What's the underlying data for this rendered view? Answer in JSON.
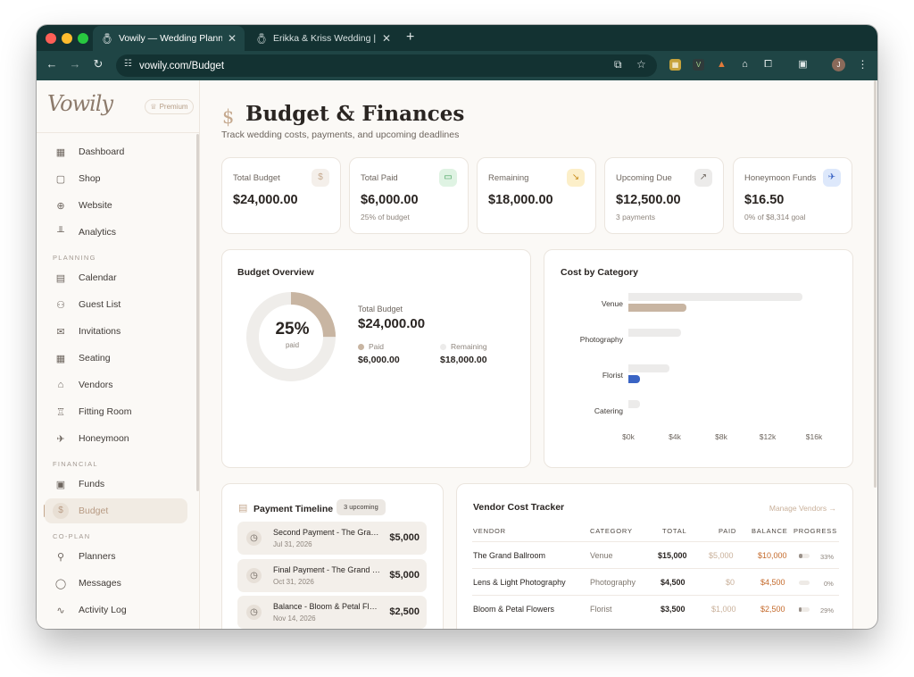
{
  "browser": {
    "tabs": [
      {
        "title": "Vowily — Wedding Planner, H",
        "active": true
      },
      {
        "title": "Erikka & Kriss Wedding | Nov",
        "active": false
      }
    ],
    "url": "vowily.com/Budget",
    "profile_initial": "J"
  },
  "sidebar": {
    "logo": "Vowily",
    "premium_label": "Premium",
    "items_top": [
      {
        "label": "Dashboard",
        "icon": "grid-icon"
      },
      {
        "label": "Shop",
        "icon": "bag-icon"
      },
      {
        "label": "Website",
        "icon": "globe-icon"
      },
      {
        "label": "Analytics",
        "icon": "chart-icon"
      }
    ],
    "section_planning": "PLANNING",
    "items_planning": [
      {
        "label": "Calendar",
        "icon": "calendar-icon"
      },
      {
        "label": "Guest List",
        "icon": "users-icon"
      },
      {
        "label": "Invitations",
        "icon": "mail-icon"
      },
      {
        "label": "Seating",
        "icon": "seating-icon"
      },
      {
        "label": "Vendors",
        "icon": "store-icon"
      },
      {
        "label": "Fitting Room",
        "icon": "dress-icon"
      },
      {
        "label": "Honeymoon",
        "icon": "plane-icon"
      }
    ],
    "section_financial": "FINANCIAL",
    "items_financial": [
      {
        "label": "Funds",
        "icon": "wallet-icon"
      },
      {
        "label": "Budget",
        "icon": "dollar-icon",
        "active": true
      }
    ],
    "section_coplan": "CO-PLAN",
    "items_coplan": [
      {
        "label": "Planners",
        "icon": "user-plus-icon"
      },
      {
        "label": "Messages",
        "icon": "message-icon"
      },
      {
        "label": "Activity Log",
        "icon": "activity-icon"
      }
    ]
  },
  "header": {
    "title": "Budget & Finances",
    "subtitle": "Track wedding costs, payments, and upcoming deadlines"
  },
  "stats": [
    {
      "label": "Total Budget",
      "value": "$24,000.00",
      "note": "",
      "icon": "dollar-icon"
    },
    {
      "label": "Total Paid",
      "value": "$6,000.00",
      "note": "25% of budget",
      "icon": "card-icon"
    },
    {
      "label": "Remaining",
      "value": "$18,000.00",
      "note": "",
      "icon": "trend-down-icon"
    },
    {
      "label": "Upcoming Due",
      "value": "$12,500.00",
      "note": "3 payments",
      "icon": "trend-up-icon"
    },
    {
      "label": "Honeymoon Funds",
      "value": "$16.50",
      "note": "0% of $8,314 goal",
      "icon": "plane-icon"
    }
  ],
  "overview": {
    "title": "Budget Overview",
    "percent": "25%",
    "percent_label": "paid",
    "paid_fraction": 0.25,
    "total_label": "Total Budget",
    "total_value": "$24,000.00",
    "paid_label": "Paid",
    "paid_value": "$6,000.00",
    "remaining_label": "Remaining",
    "remaining_value": "$18,000.00",
    "colors": {
      "paid": "#c8b5a2",
      "remaining": "#efedea"
    }
  },
  "chart_data": {
    "type": "bar",
    "orientation": "horizontal",
    "title": "Cost by Category",
    "categories": [
      "Venue",
      "Photography",
      "Florist",
      "Catering"
    ],
    "series": [
      {
        "values": [
          15000,
          4500,
          3500,
          1000
        ],
        "color": "#ecebea"
      },
      {
        "values": [
          5000,
          0,
          1000,
          0
        ],
        "color": "#c8b5a2"
      }
    ],
    "xlim": [
      0,
      16000
    ],
    "xticks": [
      "$0k",
      "$4k",
      "$8k",
      "$12k",
      "$16k"
    ],
    "highlight_color": "#3a64c4"
  },
  "timeline": {
    "title": "Payment Timeline",
    "badge": "3 upcoming",
    "payments": [
      {
        "title": "Second Payment - The Grand Ballroom",
        "date": "Jul 31, 2026",
        "amount": "$5,000"
      },
      {
        "title": "Final Payment - The Grand Ballroom",
        "date": "Oct 31, 2026",
        "amount": "$5,000"
      },
      {
        "title": "Balance - Bloom & Petal Flowers",
        "date": "Nov 14, 2026",
        "amount": "$2,500"
      }
    ]
  },
  "vendors": {
    "title": "Vendor Cost Tracker",
    "manage_label": "Manage Vendors →",
    "columns": [
      "VENDOR",
      "CATEGORY",
      "TOTAL",
      "PAID",
      "BALANCE",
      "PROGRESS"
    ],
    "rows": [
      {
        "vendor": "The Grand Ballroom",
        "category": "Venue",
        "total": "$15,000",
        "paid": "$5,000",
        "balance": "$10,000",
        "progress": "33%",
        "progress_value": 0.33
      },
      {
        "vendor": "Lens & Light Photography",
        "category": "Photography",
        "total": "$4,500",
        "paid": "$0",
        "balance": "$4,500",
        "progress": "0%",
        "progress_value": 0
      },
      {
        "vendor": "Bloom & Petal Flowers",
        "category": "Florist",
        "total": "$3,500",
        "paid": "$1,000",
        "balance": "$2,500",
        "progress": "29%",
        "progress_value": 0.29
      }
    ]
  }
}
